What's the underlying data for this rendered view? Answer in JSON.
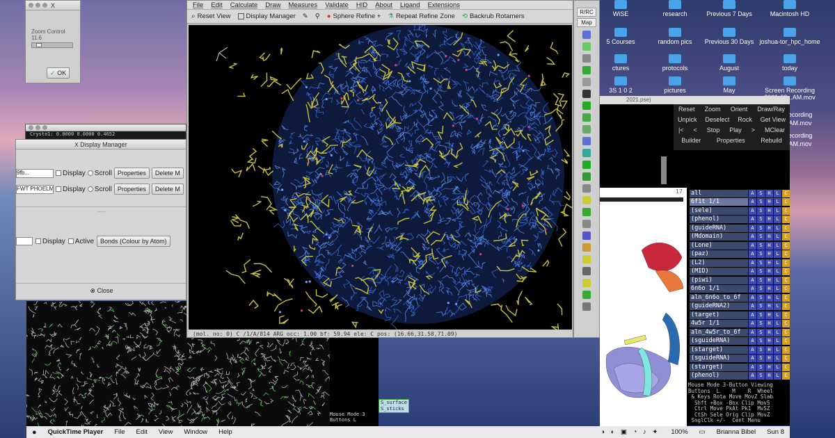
{
  "desktop": {
    "icons": [
      {
        "label": "WiSE"
      },
      {
        "label": "research"
      },
      {
        "label": "Previous 7 Days"
      },
      {
        "label": "Macintosh HD"
      },
      {
        "label": "5 Courses"
      },
      {
        "label": "random pics"
      },
      {
        "label": "Previous 30 Days"
      },
      {
        "label": "joshua-tor_hpc_home"
      },
      {
        "label": "ctures"
      },
      {
        "label": "protocols"
      },
      {
        "label": "August"
      },
      {
        "label": "today"
      },
      {
        "label": "3S 1 0 2"
      },
      {
        "label": "pictures"
      },
      {
        "label": "May"
      },
      {
        "label": "Screen Recording 2021-08...AM.mov"
      },
      {
        "label": "ecording"
      },
      {
        "label": "AM.mov"
      },
      {
        "label": "ecording"
      },
      {
        "label": "AM.mov"
      }
    ]
  },
  "zoom_window": {
    "title": "X",
    "label": "Zoom Control",
    "value": "11.6",
    "ok_label": "OK"
  },
  "readout_window": {
    "text": "Crysto1:  0.0000   0.0000   0.4652"
  },
  "display_manager": {
    "title": "Display Manager",
    "rows": [
      {
        "name": "9fb...",
        "display": "Display",
        "scroll": "Scroll",
        "properties": "Properties",
        "delete": "Delete M"
      },
      {
        "name": "FWT PHOELM",
        "display": "Display",
        "scroll": "Scroll",
        "properties": "Properties",
        "delete": "Delete M"
      }
    ],
    "mol_row": {
      "display": "Display",
      "active": "Active",
      "bonds": "Bonds (Colour by Atom)"
    },
    "close_label": "Close"
  },
  "coot": {
    "menu": [
      "File",
      "Edit",
      "Calculate",
      "Draw",
      "Measures",
      "Validate",
      "HID",
      "About",
      "Ligand",
      "Extensions"
    ],
    "toolbar": {
      "reset_view": "Reset View",
      "display_manager": "Display Manager",
      "sphere_refine": "Sphere Refine +",
      "repeat_refine": "Repeat Refine Zone",
      "backrub": "Backrub Rotamers"
    },
    "status": "(mol. no: 0)  C  /1/A/814 ARG occ:  1.00 bf: 59.94 ele:  C pos: (16.66,31.58,71.09)"
  },
  "coot_side": {
    "rpc_label": "R/RC",
    "map_label": "Map"
  },
  "pymol_ctrl": {
    "row1": [
      "Reset",
      "Zoom",
      "Orient",
      "Draw/Ray"
    ],
    "row2": [
      "Unpick",
      "Deselect",
      "Rock",
      "Get View"
    ],
    "row3": [
      "|<",
      "<",
      "Stop",
      "Play",
      ">",
      "MClear"
    ],
    "row4": [
      "Builder",
      "Properties",
      "Rebuild"
    ]
  },
  "pymol_top_strip": {
    "filename": "2021.pse)",
    "frame": "17"
  },
  "pymol_objects": [
    {
      "name": "all",
      "hl": false
    },
    {
      "name": "6f1t 1/1",
      "hl": true
    },
    {
      "name": "(sele)",
      "hl": false
    },
    {
      "name": "(phenol)",
      "hl": false
    },
    {
      "name": "(guideRNA)",
      "hl": false
    },
    {
      "name": "(Mdomain)",
      "hl": false
    },
    {
      "name": "(Lone)",
      "hl": false
    },
    {
      "name": "(paz)",
      "hl": false
    },
    {
      "name": "(L2)",
      "hl": false
    },
    {
      "name": "(MID)",
      "hl": false
    },
    {
      "name": "(piwi)",
      "hl": false
    },
    {
      "name": "6n6o 1/1",
      "hl": false
    },
    {
      "name": "aln_6n6o_to_6f",
      "hl": false
    },
    {
      "name": "(guideRNA2)",
      "hl": false
    },
    {
      "name": "(target)",
      "hl": false
    },
    {
      "name": "4w5r 1/1",
      "hl": false
    },
    {
      "name": "aln_4w5r_to_6f",
      "hl": false
    },
    {
      "name": "(sguideRNA)",
      "hl": false
    },
    {
      "name": "(starget)",
      "hl": false
    },
    {
      "name": "(sguideRNA)",
      "hl": false
    },
    {
      "name": "(starget)",
      "hl": false
    },
    {
      "name": "(phenol)",
      "hl": false
    }
  ],
  "pymol_obj_buttons": [
    "A",
    "S",
    "H",
    "L",
    "C"
  ],
  "mouse_panel": "Mouse Mode 3-Button Viewing\nButtons  L    M    R  Wheel\n & Keys Rota Move MovZ Slab\n  Shft +Box -Box Clip MovS\n  Ctrl Move PkAt Pk1  MvSZ\n  CtSh Sele Orig Clip MovZ\n SnglClk +/-  Cent Menu",
  "lower_mid": {
    "mode": "Mouse Mode 3",
    "buttons": "Buttons L",
    "surface": "S_surface",
    "sticks": "S_sticks"
  },
  "menubar": {
    "app": "QuickTime Player",
    "items": [
      "File",
      "Edit",
      "View",
      "Window",
      "Help"
    ],
    "battery": "100%",
    "user": "Brianna Bibel",
    "time": "Sun 8"
  },
  "colors": {
    "density_blue": "#3a6fd8",
    "model_yellow": "#c8c23c",
    "pymol_purple": "#8f8fd6",
    "pymol_red": "#c8283c",
    "pymol_cyan": "#7fe6e0"
  }
}
